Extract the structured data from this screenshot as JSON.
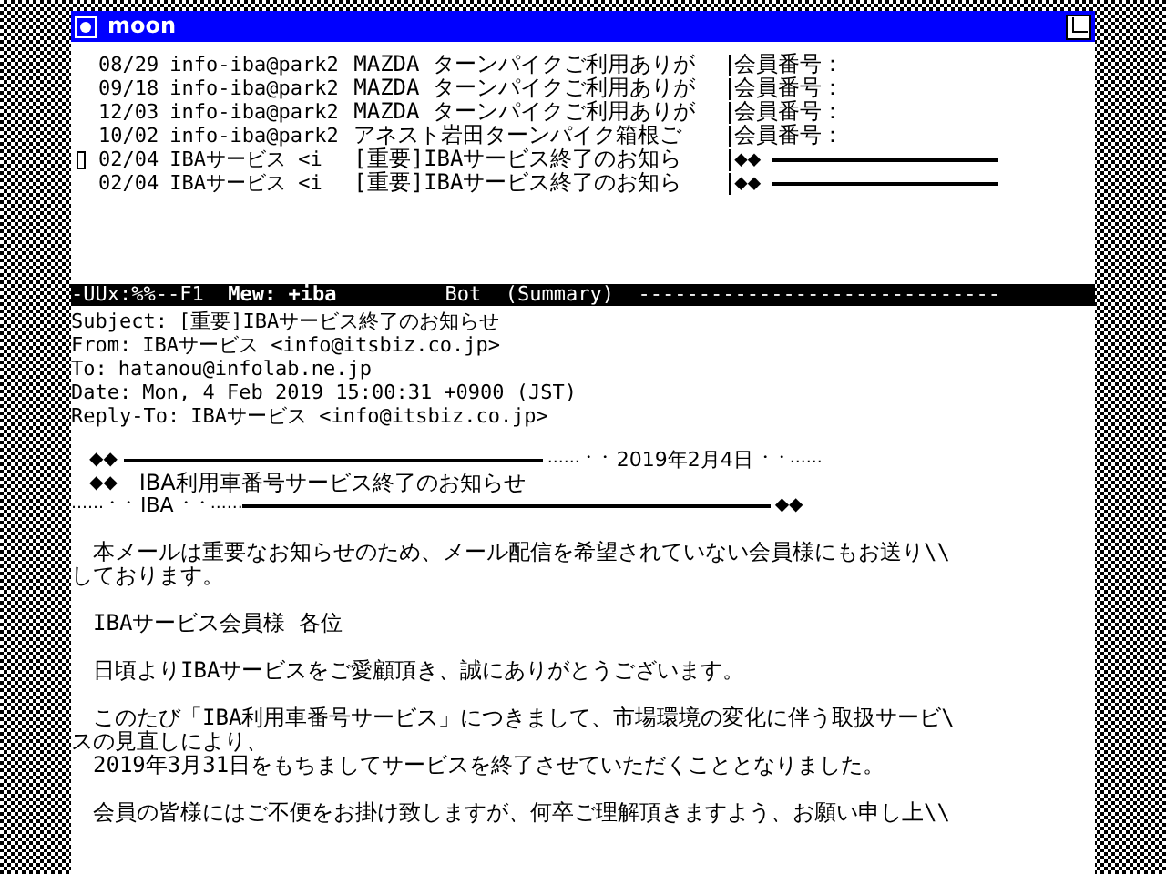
{
  "window": {
    "title": "moon"
  },
  "summary": {
    "rows": [
      {
        "date": "08/29",
        "from": "info-iba@park2",
        "subject": "MAZDA ターンパイクご利用ありが",
        "preview": "会員番号：",
        "rule": false,
        "current": false
      },
      {
        "date": "09/18",
        "from": "info-iba@park2",
        "subject": "MAZDA ターンパイクご利用ありが",
        "preview": "会員番号：",
        "rule": false,
        "current": false
      },
      {
        "date": "12/03",
        "from": "info-iba@park2",
        "subject": "MAZDA ターンパイクご利用ありが",
        "preview": "会員番号：",
        "rule": false,
        "current": false
      },
      {
        "date": "10/02",
        "from": "info-iba@park2",
        "subject": "アネスト岩田ターンパイク箱根ご",
        "preview": "会員番号：",
        "rule": false,
        "current": false
      },
      {
        "date": "02/04",
        "from": "IBAサービス <i",
        "subject": "[重要]IBAサービス終了のお知ら",
        "preview": "◆◆",
        "rule": true,
        "current": true
      },
      {
        "date": "02/04",
        "from": "IBAサービス <i",
        "subject": "[重要]IBAサービス終了のお知ら",
        "preview": "◆◆",
        "rule": true,
        "current": false
      }
    ]
  },
  "mode_line": "-UUx:%%--F1  **Mew: +iba**         Bot  (Summary)  ------------------------------",
  "headers": [
    {
      "name": "Subject:",
      "value": "[重要]IBAサービス終了のお知らせ"
    },
    {
      "name": "From:",
      "value": "IBAサービス <info@itsbiz.co.jp>"
    },
    {
      "name": "To:",
      "value": "hatanou@infolab.ne.jp"
    },
    {
      "name": "Date:",
      "value": "Mon, 4 Feb 2019 15:00:31 +0900 (JST)"
    },
    {
      "name": "Reply-To:",
      "value": "IBAサービス <info@itsbiz.co.jp>"
    }
  ],
  "banner": {
    "mark_top": "◆◆",
    "date_left": "……・・",
    "date": "2019年2月4日",
    "date_right": "・・……",
    "mark_mid": "◆◆",
    "title": "IBA利用車番号サービス終了のお知らせ",
    "sender_left": "……・・",
    "sender": "IBA",
    "sender_right": "・・……",
    "mark_end": "◆◆"
  },
  "paragraphs": [
    [
      "　本メールは重要なお知らせのため、メール配信を希望されていない会員様にもお送り\\\\",
      "しております。"
    ],
    [
      "　IBAサービス会員様 各位"
    ],
    [
      "　日頃よりIBAサービスをご愛顧頂き、誠にありがとうございます。"
    ],
    [
      "　このたび「IBA利用車番号サービス」につきまして、市場環境の変化に伴う取扱サービ\\",
      "スの見直しにより、",
      "　2019年3月31日をもちましてサービスを終了させていただくこととなりました。"
    ],
    [
      "　会員の皆様にはご不便をお掛け致しますが、何卒ご理解頂きますよう、お願い申し上\\\\"
    ]
  ]
}
